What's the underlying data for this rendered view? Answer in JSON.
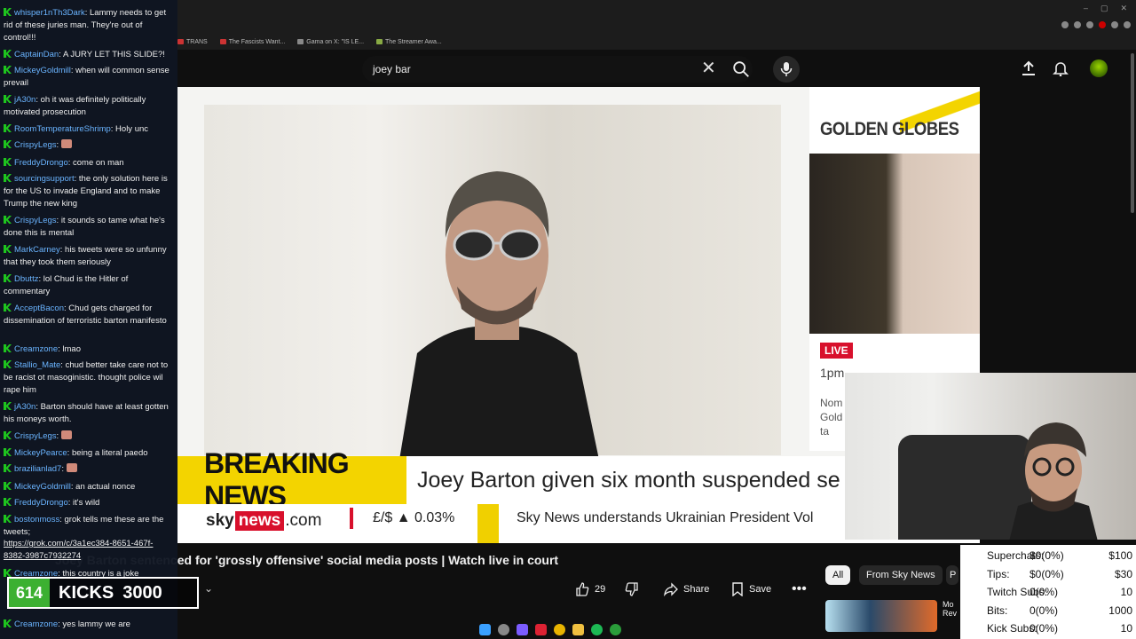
{
  "browser": {
    "bookmarks": [
      "TRANS",
      "The Fascists Want...",
      "Gama on X: \"IS LE...",
      "The Streamer Awa..."
    ]
  },
  "topbar": {
    "search_value": "joey bar"
  },
  "video": {
    "golden_globes_title": "GOLDEN GLOBES",
    "live_label": "LIVE",
    "golden_time": "1pm",
    "golden_desc": "Nom Gold to ta",
    "breaking_label": "BREAKING NEWS",
    "breaking_headline": "Joey Barton given six month suspended se",
    "sky_prefix": "sky",
    "sky_news": "news",
    "sky_suffix": ".com",
    "fx_label": "£/$ ▲ 0.03%",
    "ticker_text": "Sky News understands Ukrainian President Vol"
  },
  "info": {
    "title": "Joey Barton sentenced for 'grossly offensive' social media posts | Watch live in court",
    "likes": "29",
    "share": "Share",
    "save": "Save",
    "chips": [
      "All",
      "From Sky News",
      "P"
    ],
    "rec_title": "Mo Rev"
  },
  "chat": [
    {
      "user": "whisper1nTh3Dark",
      "text": "Lammy needs to get rid of these juries man. They're out of control!!!"
    },
    {
      "user": "CaptainDan",
      "text": "A JURY LET THIS SLIDE?!"
    },
    {
      "user": "MickeyGoldmill",
      "text": "when will common sense prevail"
    },
    {
      "user": "jA30n",
      "text": "oh it was definitely politically motivated prosecution"
    },
    {
      "user": "RoomTemperatureShrimp",
      "text": "Holy unc"
    },
    {
      "user": "CrispyLegs",
      "text": "",
      "emote": true
    },
    {
      "user": "FreddyDrongo",
      "text": "come on man"
    },
    {
      "user": "sourcingsupport",
      "text": "the only solution here is for the US to invade England and to make Trump the new king"
    },
    {
      "user": "CrispyLegs",
      "text": "it sounds so tame what he's done this is mental"
    },
    {
      "user": "MarkCarney",
      "text": "his tweets were so unfunny that they took them seriously"
    },
    {
      "user": "Dbuttz",
      "text": "lol Chud is the Hitler of commentary"
    },
    {
      "user": "AcceptBacon",
      "text": "Chud gets charged for dissemination of terroristic barton manifesto"
    },
    {
      "user": "Creamzone",
      "text": "lmao"
    },
    {
      "user": "Stallio_Mate",
      "text": "chud better take care not to be racist ot masoginistic. thought police wil rape him"
    },
    {
      "user": "jA30n",
      "text": "Barton should have at least gotten his moneys worth."
    },
    {
      "user": "CrispyLegs",
      "text": "",
      "emote": true
    },
    {
      "user": "MickeyPearce",
      "text": "being a literal paedo"
    },
    {
      "user": "brazilianlad7",
      "text": "",
      "emote": true
    },
    {
      "user": "MickeyGoldmill",
      "text": "an actual nonce"
    },
    {
      "user": "FreddyDrongo",
      "text": "it's wild"
    },
    {
      "user": "bostonmoss",
      "text": "grok tells me these are the tweets;"
    },
    {
      "user": "",
      "text": "https://grok.com/c/3a1ec384-8651-467f-8382-3987c7932274",
      "link": true
    },
    {
      "user": "Creamzone",
      "text": "this country is a joke"
    },
    {
      "user": "Creamzone",
      "text": "yes lammy we are"
    }
  ],
  "kicks": {
    "count": "614",
    "label": "KICKS",
    "goal": "3000"
  },
  "stats": [
    {
      "label": "Superchats:",
      "value": "$0(0%)",
      "goal": "$100"
    },
    {
      "label": "Tips:",
      "value": "$0(0%)",
      "goal": "$30"
    },
    {
      "label": "Twitch Subs:",
      "value": "0(0%)",
      "goal": "10"
    },
    {
      "label": "Bits:",
      "value": "0(0%)",
      "goal": "1000"
    },
    {
      "label": "Kick Subs:",
      "value": "0(0%)",
      "goal": "10"
    }
  ],
  "colors": {
    "breaking_yellow": "#f3d400",
    "sky_red": "#d8102c",
    "kick_green": "#3cb031",
    "chat_user": "#6ab4ff"
  }
}
